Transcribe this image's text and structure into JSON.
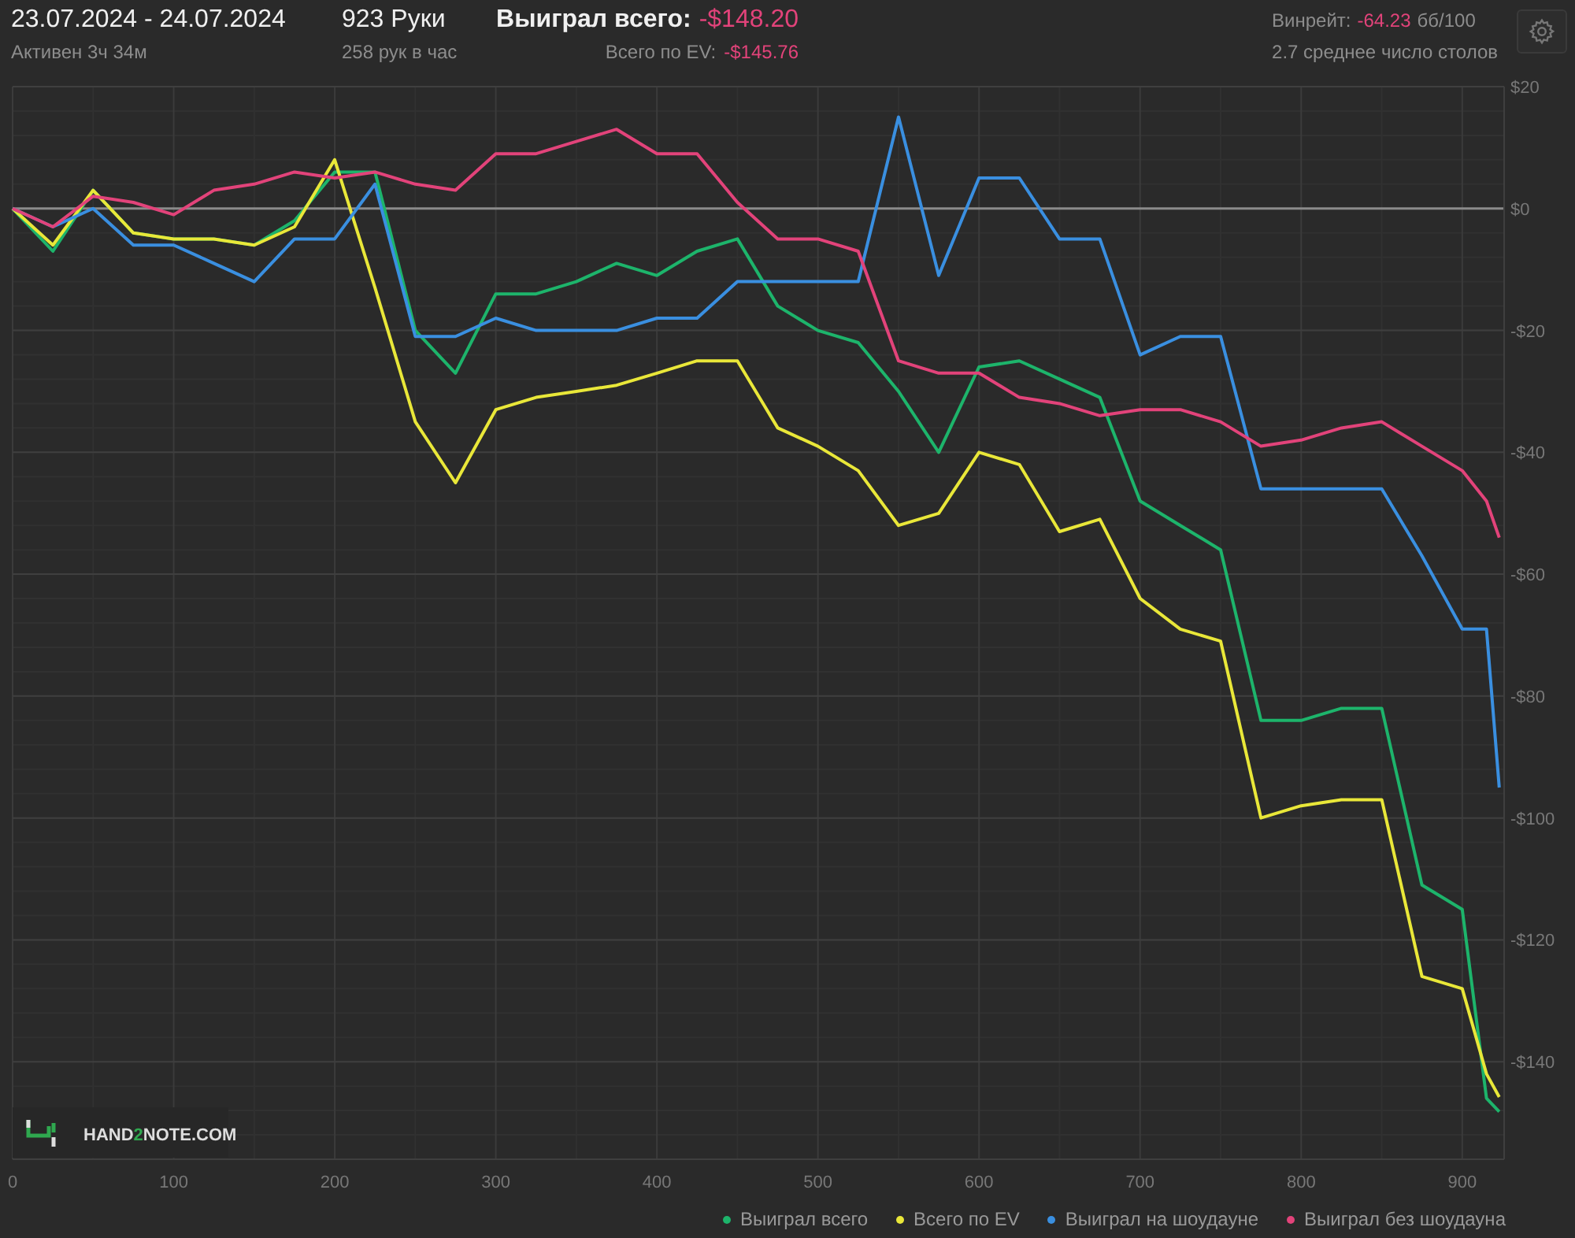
{
  "header": {
    "date_range": "23.07.2024 - 24.07.2024",
    "active_time": "Активен 3ч 34м",
    "hands": "923 Руки",
    "hands_per_hour": "258 рук в час",
    "won_total": {
      "label": "Выиграл всего:",
      "value": "-$148.20"
    },
    "ev_total": {
      "label": "Всего по EV:",
      "value": "-$145.76"
    },
    "winrate": {
      "label": "Винрейт:",
      "value": "-64.23",
      "unit": "бб/100"
    },
    "avg_tables": "2.7 среднее число столов"
  },
  "chart": {
    "logo": {
      "before": "HAND",
      "accent": "2",
      "after": "NOTE.COM"
    },
    "chart_data": {
      "type": "line",
      "x": [
        0,
        25,
        50,
        75,
        100,
        125,
        150,
        175,
        200,
        225,
        250,
        275,
        300,
        325,
        350,
        375,
        400,
        425,
        450,
        475,
        500,
        525,
        550,
        575,
        600,
        625,
        650,
        675,
        700,
        725,
        750,
        775,
        800,
        825,
        850,
        875,
        900,
        915,
        923
      ],
      "series": [
        {
          "name": "Выиграл всего",
          "color": "#1db46b",
          "values": [
            0,
            -7,
            3,
            -4,
            -5,
            -5,
            -6,
            -2,
            6,
            6,
            -20,
            -27,
            -14,
            -14,
            -12,
            -9,
            -11,
            -7,
            -5,
            -16,
            -20,
            -22,
            -30,
            -40,
            -26,
            -25,
            -28,
            -31,
            -48,
            -52,
            -56,
            -84,
            -84,
            -82,
            -82,
            -111,
            -115,
            -146,
            -148.2
          ]
        },
        {
          "name": "Всего по EV",
          "color": "#e9e739",
          "values": [
            0,
            -6,
            3,
            -4,
            -5,
            -5,
            -6,
            -3,
            8,
            -13,
            -35,
            -45,
            -33,
            -31,
            -30,
            -29,
            -27,
            -25,
            -25,
            -36,
            -39,
            -43,
            -52,
            -50,
            -40,
            -42,
            -53,
            -51,
            -64,
            -69,
            -71,
            -100,
            -98,
            -97,
            -97,
            -126,
            -128,
            -142,
            -145.8
          ]
        },
        {
          "name": "Выиграл на шоудауне",
          "color": "#3a8fe0",
          "values": [
            0,
            -3,
            0,
            -6,
            -6,
            -9,
            -12,
            -5,
            -5,
            4,
            -21,
            -21,
            -18,
            -20,
            -20,
            -20,
            -18,
            -18,
            -12,
            -12,
            -12,
            -12,
            15,
            -11,
            5,
            5,
            -5,
            -5,
            -24,
            -21,
            -21,
            -46,
            -46,
            -46,
            -46,
            -57,
            -69,
            -69,
            -95
          ]
        },
        {
          "name": "Выиграл без шоудауна",
          "color": "#e2437a",
          "values": [
            0,
            -3,
            2,
            1,
            -1,
            3,
            4,
            6,
            5,
            6,
            4,
            3,
            9,
            9,
            11,
            13,
            9,
            9,
            1,
            -5,
            -5,
            -7,
            -25,
            -27,
            -27,
            -31,
            -32,
            -34,
            -33,
            -33,
            -35,
            -39,
            -38,
            -36,
            -35,
            -39,
            -43,
            -48,
            -54
          ]
        }
      ],
      "grid": true,
      "xlim": [
        0,
        926
      ],
      "ylim": [
        -156,
        20
      ],
      "xticks": [
        0,
        100,
        200,
        300,
        400,
        500,
        600,
        700,
        800,
        900
      ],
      "yticks": [
        {
          "value": 20,
          "label": "$20"
        },
        {
          "value": 0,
          "label": "$0"
        },
        {
          "value": -20,
          "label": "-$20"
        },
        {
          "value": -40,
          "label": "-$40"
        },
        {
          "value": -60,
          "label": "-$60"
        },
        {
          "value": -80,
          "label": "-$80"
        },
        {
          "value": -100,
          "label": "-$100"
        },
        {
          "value": -120,
          "label": "-$120"
        },
        {
          "value": -140,
          "label": "-$140"
        }
      ]
    }
  }
}
